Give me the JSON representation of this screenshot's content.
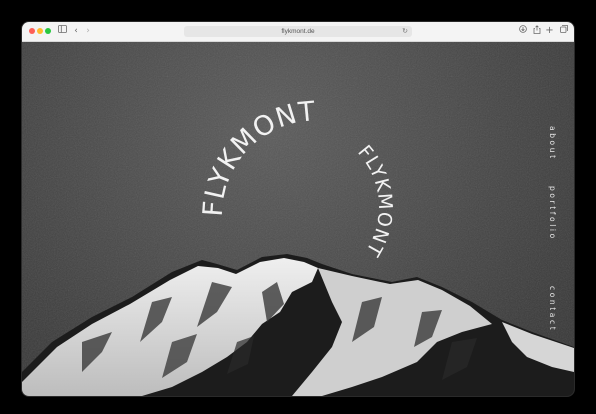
{
  "browser": {
    "url": "flykmont.de",
    "icons": {
      "sidebar": "sidebar-icon",
      "back": "chevron-left-icon",
      "forward": "chevron-right-icon",
      "reload": "reload-icon",
      "download": "download-icon",
      "share": "share-icon",
      "new_tab": "plus-icon",
      "tabs": "tabs-icon"
    }
  },
  "site": {
    "logo_word_1": "FLYKMONT",
    "logo_word_2": "FLYKMONT",
    "nav": [
      {
        "label": "about"
      },
      {
        "label": "portfolio"
      },
      {
        "label": "contact"
      }
    ]
  },
  "colors": {
    "traffic_red": "#fe5f57",
    "traffic_yellow": "#febc2e",
    "traffic_green": "#28c840",
    "page_background": "#444444",
    "logo_text": "#f2f2f2"
  }
}
